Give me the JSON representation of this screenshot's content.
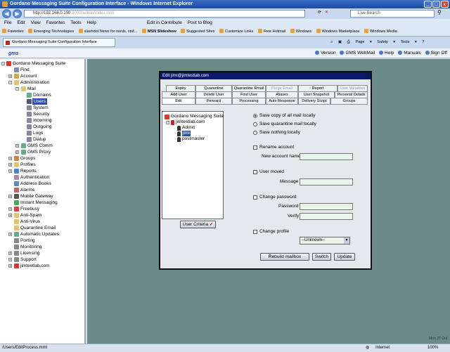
{
  "window": {
    "title": "Gordano Messaging Suite Configuration Interface - Windows Internet Explorer"
  },
  "address": {
    "url_main": "http://192.168.0.190",
    "url_rest": ":8000/admin/index.mml",
    "search_placeholder": "Live Search"
  },
  "menu": [
    "File",
    "Edit",
    "View",
    "Favorites",
    "Tools",
    "Help"
  ],
  "menu_extra": {
    "contribute": "Edit in Contribute",
    "blog": "Post to Blog"
  },
  "favorites": {
    "label": "Favorites",
    "items": [
      "Emerging Technologies",
      "slashdot News for nerds, stuf...",
      "MSN Slideshow",
      "Suggested Sites",
      "Customize Links",
      "Free Hotmail",
      "Windows",
      "Windows Marketplace",
      "Windows Media"
    ]
  },
  "tab": {
    "title": "Gordano Messaging Suite Configuration Interface"
  },
  "tab_tools": [
    "Page",
    "Safety",
    "Tools"
  ],
  "app_header": {
    "logo": "gms",
    "links": [
      "Version",
      "GMS WebMail",
      "Help",
      "Manuals",
      "Sign Off"
    ]
  },
  "sidebar": {
    "root": "Gordano Messaging Suite",
    "find": "Find",
    "account": "Account",
    "administration": "Administration",
    "mail": "Mail",
    "domains": "Domains",
    "users": "Users",
    "system": "System",
    "security": "Security",
    "incoming": "Incoming",
    "outgoing": "Outgoing",
    "logs": "Logs",
    "dialup": "Dialup",
    "gms_comm": "GMS Comm",
    "gms_proxy": "GMS Proxy",
    "groups": "Groups",
    "profiles": "Profiles",
    "reports": "Reports",
    "authentication": "Authentication",
    "address_books": "Address Books",
    "alarms": "Alarms",
    "mobile_gateway": "Mobile Gateway",
    "instant_messaging": "Instant Messaging",
    "freebusy": "Freebusy",
    "anti_spam": "Anti-Spam",
    "anti_virus": "Anti-Virus",
    "quarantine_email": "Quarantine Email",
    "automatic_updates": "Automatic Updates",
    "porting": "Porting",
    "monitoring": "Monitoring",
    "licensing": "Licensing",
    "support": "Support",
    "domain": "jimtestlab.com"
  },
  "dialog": {
    "title": "Edit jimr@jimtestlab.com",
    "tabs_row1": [
      "Expiry",
      "Quarantine",
      "Quarantine Email",
      "Purge Email",
      "Report",
      "User Variables"
    ],
    "tabs_row2": [
      "Add User",
      "Delete User",
      "Find User",
      "Aliases",
      "User Snapshot",
      "Personal Details"
    ],
    "tabs_row3": [
      "Edit",
      "Forward",
      "Processing",
      "Auto Response",
      "Delivery Script",
      "Groups"
    ],
    "tree": {
      "root": "Gordano Messaging Suite",
      "domain": "jimtestlab.com",
      "users": [
        "Admin",
        "jimr",
        "postmaster"
      ]
    },
    "user_criteria": "User Criteria",
    "radio": [
      "Save copy of all mail locally",
      "Save quarantine mail locally",
      "Save nothing locally"
    ],
    "rename_account": "Rename account",
    "new_account_name": "New account name",
    "user_moved": "User moved",
    "message": "Message",
    "change_password": "Change password",
    "password": "Password",
    "verify": "Verify",
    "change_profile": "Change profile",
    "profile_value": "--Unknown--",
    "buttons": {
      "rebuild": "Rebuild mailbox",
      "switch": "Switch",
      "update": "Update"
    }
  },
  "app_status": "Mon 27 Oct",
  "ie_status": {
    "url": "/Users/EditProcess.mml",
    "zone": "Internet",
    "zoom": "100%"
  }
}
